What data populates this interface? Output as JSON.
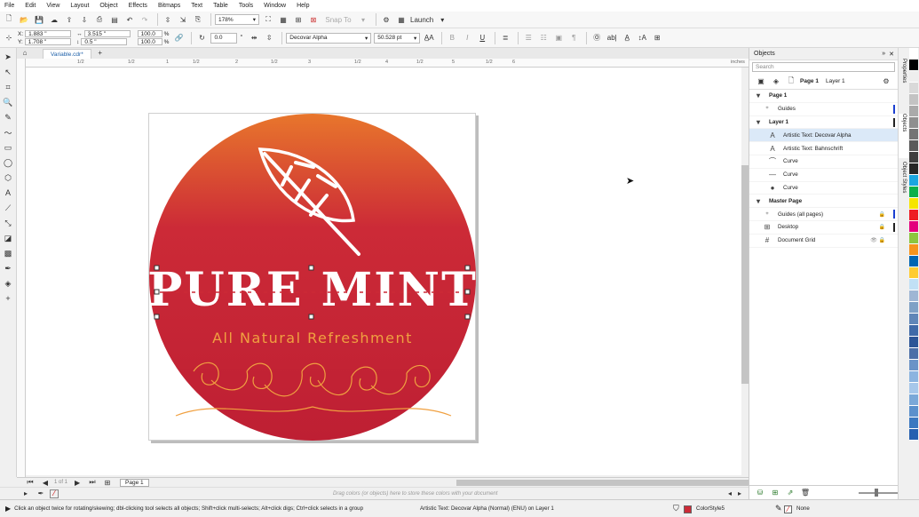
{
  "menubar": [
    "File",
    "Edit",
    "View",
    "Layout",
    "Object",
    "Effects",
    "Bitmaps",
    "Text",
    "Table",
    "Tools",
    "Window",
    "Help"
  ],
  "toolbar": {
    "zoom": "178%",
    "snap_to": "Snap To",
    "launch": "Launch"
  },
  "propbar": {
    "x_label": "X:",
    "x_value": "1.883 \"",
    "y_label": "Y:",
    "y_value": "1.708 \"",
    "w_value": "3.515 \"",
    "h_value": "0.5 \"",
    "scale_w": "100.0",
    "scale_h": "100.0",
    "percent": "%",
    "rotation": "0.0",
    "degree": "°",
    "font": "Decovar Alpha",
    "font_size": "50.528 pt",
    "bold": "B",
    "italic": "I",
    "underline": "U"
  },
  "document": {
    "tab": "Variable.cdr*",
    "page_tab": "Page 1",
    "page_nav": "1 of 1"
  },
  "artwork": {
    "title": "PURE MINT",
    "tagline": "All Natural Refreshment",
    "colors": {
      "circle_top": "#e8762c",
      "circle_mid": "#cc2a37",
      "circle_bottom": "#be1f33",
      "tagline": "#f0a040"
    }
  },
  "ruler_labels": [
    "1/2",
    "1/2",
    "1",
    "1/2",
    "2",
    "1/2",
    "3",
    "1/2",
    "4",
    "1/2",
    "5",
    "1/2",
    "6",
    "inches"
  ],
  "hint": "Drag colors (or objects) here to store these colors with your document",
  "docker": {
    "title": "Objects",
    "search_placeholder": "Search",
    "page": "Page 1",
    "layer": "Layer 1",
    "rows": [
      {
        "label": "Page 1",
        "icon": "▾",
        "indent": 4,
        "bold": true,
        "sel": false,
        "lock": "",
        "color": ""
      },
      {
        "label": "Guides",
        "icon": "⁺",
        "indent": 14,
        "bold": false,
        "sel": false,
        "lock": "",
        "color": "#1b3fd1"
      },
      {
        "label": "Layer 1",
        "icon": "▾",
        "indent": 4,
        "bold": true,
        "sel": false,
        "lock": "",
        "color": "#222"
      },
      {
        "label": "Artistic Text: Decovar Alpha",
        "icon": "A",
        "indent": 20,
        "bold": false,
        "sel": true,
        "lock": "",
        "color": ""
      },
      {
        "label": "Artistic Text: Bahnschrift",
        "icon": "A",
        "indent": 20,
        "bold": false,
        "sel": false,
        "lock": "",
        "color": ""
      },
      {
        "label": "Curve",
        "icon": "⌒",
        "indent": 20,
        "bold": false,
        "sel": false,
        "lock": "",
        "color": ""
      },
      {
        "label": "Curve",
        "icon": "—",
        "indent": 20,
        "bold": false,
        "sel": false,
        "lock": "",
        "color": ""
      },
      {
        "label": "Curve",
        "icon": "●",
        "indent": 20,
        "bold": false,
        "sel": false,
        "lock": "",
        "color": ""
      },
      {
        "label": "Master Page",
        "icon": "▾",
        "indent": 4,
        "bold": true,
        "sel": false,
        "lock": "",
        "color": ""
      },
      {
        "label": "Guides (all pages)",
        "icon": "⁺",
        "indent": 14,
        "bold": false,
        "sel": false,
        "lock": "🔒",
        "color": "#1b3fd1"
      },
      {
        "label": "Desktop",
        "icon": "⊞",
        "indent": 14,
        "bold": false,
        "sel": false,
        "lock": "🔒",
        "color": "#222"
      },
      {
        "label": "Document Grid",
        "icon": "#",
        "indent": 14,
        "bold": false,
        "sel": false,
        "lock": "👁 🔒",
        "color": ""
      }
    ]
  },
  "side_tabs": [
    "Properties",
    "Objects",
    "Object Styles"
  ],
  "status": {
    "message": "Click an object twice for rotating/skewing; dbl-clicking tool selects all objects; Shift+click multi-selects; Alt+click digs; Ctrl+click selects in a group",
    "selection": "Artistic Text: Decovar Alpha (Normal) (ENU) on Layer 1",
    "fill": "ColorStyle5",
    "outline": "None"
  },
  "palette": [
    "#ffffff",
    "#000000",
    "#eeeeee",
    "#d9d9d9",
    "#c3c3c3",
    "#aaaaaa",
    "#8f8f8f",
    "#747474",
    "#5a5a5a",
    "#3f3f3f",
    "#262626",
    "#1aa6e0",
    "#0bb04b",
    "#f6e500",
    "#ee1c24",
    "#e3007d",
    "#8dc63f",
    "#f7941d",
    "#0066b3",
    "#ffcc33",
    "#c1e0f5",
    "#9fb6d4",
    "#7fa1c6",
    "#5f86b8",
    "#3f6aa8",
    "#2c5597",
    "#4b6fa8",
    "#6b93c7",
    "#8bb4e0",
    "#a6c7ea",
    "#7aa8d8",
    "#5a90cc",
    "#3a78c0",
    "#2660b0"
  ]
}
